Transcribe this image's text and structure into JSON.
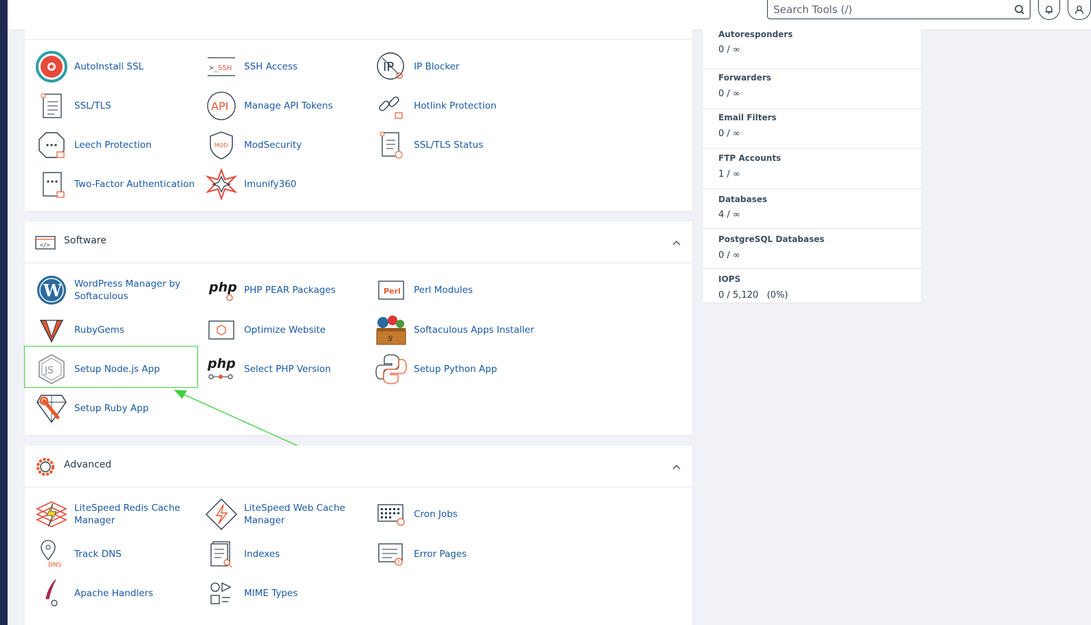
{
  "header": {
    "search_placeholder": "Search Tools (/)",
    "icons": [
      "search-icon",
      "bell-icon",
      "user-icon"
    ]
  },
  "security": {
    "tools": [
      {
        "label": "AutoInstall SSL",
        "icon": "autoinstall-ssl-icon"
      },
      {
        "label": "SSH Access",
        "icon": "terminal-ssh-icon"
      },
      {
        "label": "IP Blocker",
        "icon": "ip-blocker-icon"
      },
      {
        "label": "SSL/TLS",
        "icon": "certificate-icon"
      },
      {
        "label": "Manage API Tokens",
        "icon": "api-icon"
      },
      {
        "label": "Hotlink Protection",
        "icon": "hotlink-icon"
      },
      {
        "label": "Leech Protection",
        "icon": "leech-icon"
      },
      {
        "label": "ModSecurity",
        "icon": "modsecurity-icon"
      },
      {
        "label": "SSL/TLS Status",
        "icon": "ssl-status-icon"
      },
      {
        "label": "Two-Factor Authentication",
        "icon": "two-factor-icon"
      },
      {
        "label": "Imunify360",
        "icon": "imunify-icon"
      }
    ]
  },
  "software": {
    "title": "Software",
    "tools": [
      {
        "label": "WordPress Manager by Softaculous",
        "icon": "wordpress-icon"
      },
      {
        "label": "PHP PEAR Packages",
        "icon": "php-pear-icon"
      },
      {
        "label": "Perl Modules",
        "icon": "perl-icon"
      },
      {
        "label": "RubyGems",
        "icon": "rubygems-icon"
      },
      {
        "label": "Optimize Website",
        "icon": "optimize-icon"
      },
      {
        "label": "Softaculous Apps Installer",
        "icon": "softaculous-icon"
      },
      {
        "label": "Setup Node.js App",
        "icon": "nodejs-icon"
      },
      {
        "label": "Select PHP Version",
        "icon": "php-version-icon"
      },
      {
        "label": "Setup Python App",
        "icon": "python-icon"
      },
      {
        "label": "Setup Ruby App",
        "icon": "ruby-icon"
      }
    ]
  },
  "advanced": {
    "title": "Advanced",
    "tools": [
      {
        "label": "LiteSpeed Redis Cache Manager",
        "icon": "redis-icon"
      },
      {
        "label": "LiteSpeed Web Cache Manager",
        "icon": "litespeed-icon"
      },
      {
        "label": "Cron Jobs",
        "icon": "cron-icon"
      },
      {
        "label": "Track DNS",
        "icon": "dns-icon"
      },
      {
        "label": "Indexes",
        "icon": "indexes-icon"
      },
      {
        "label": "Error Pages",
        "icon": "error-pages-icon"
      },
      {
        "label": "Apache Handlers",
        "icon": "apache-icon"
      },
      {
        "label": "MIME Types",
        "icon": "mime-icon"
      }
    ]
  },
  "stats": [
    {
      "label": "Autoresponders",
      "value": "0 / ∞"
    },
    {
      "label": "Forwarders",
      "value": "0 / ∞"
    },
    {
      "label": "Email Filters",
      "value": "0 / ∞"
    },
    {
      "label": "FTP Accounts",
      "value": "1 / ∞"
    },
    {
      "label": "Databases",
      "value": "4 / ∞"
    },
    {
      "label": "PostgreSQL Databases",
      "value": "0 / ∞"
    },
    {
      "label": "IOPS",
      "value": "0 / 5,120   (0%)"
    }
  ],
  "colors": {
    "link": "#1a59a4",
    "accent": "#e8582c",
    "highlight": "#3ecf3e",
    "sidebar": "#1f2a50"
  }
}
